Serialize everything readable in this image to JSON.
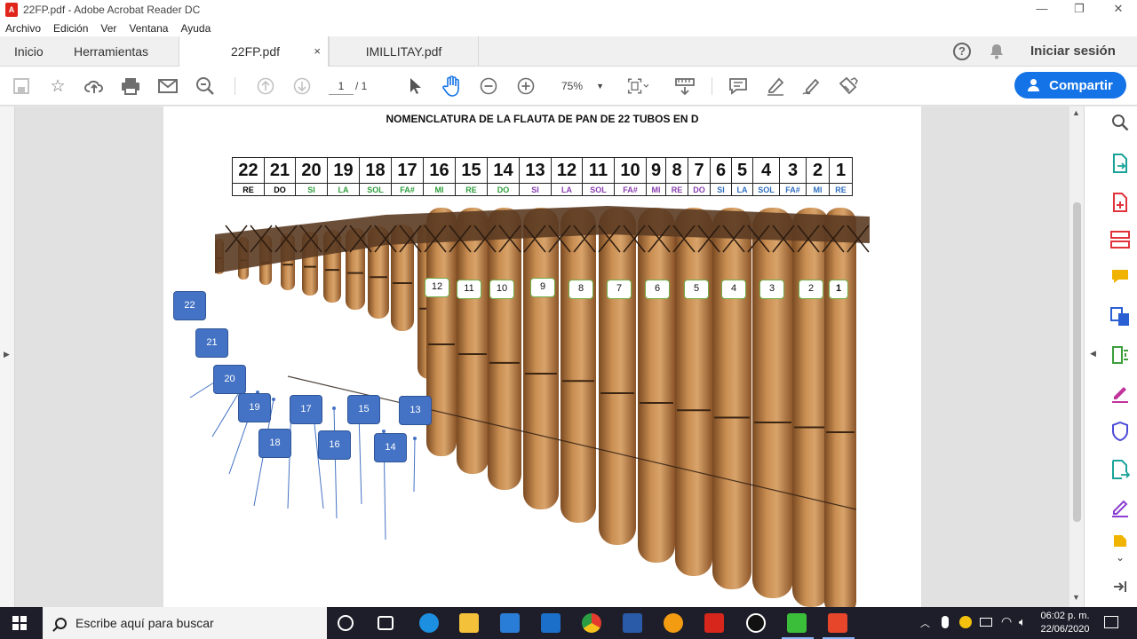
{
  "window": {
    "title": "22FP.pdf - Adobe Acrobat Reader DC",
    "controls": {
      "minimize": "—",
      "restore": "❐",
      "close": "✕"
    }
  },
  "menu": [
    "Archivo",
    "Edición",
    "Ver",
    "Ventana",
    "Ayuda"
  ],
  "tabs": {
    "home": "Inicio",
    "tools": "Herramientas",
    "documents": [
      {
        "label": "22FP.pdf",
        "close": "×",
        "active": true
      },
      {
        "label": "IMILLITAY.pdf",
        "active": false
      }
    ],
    "help_icon": "?",
    "signin": "Iniciar sesión"
  },
  "toolbar": {
    "page_current": "1",
    "page_total": "/   1",
    "zoom": "75%",
    "share": "Compartir"
  },
  "document": {
    "title": "NOMENCLATURA DE LA FLAUTA DE PAN DE 22 TUBOS EN D",
    "table": [
      {
        "num": "22",
        "note": "RE",
        "color": "#000000"
      },
      {
        "num": "21",
        "note": "DO",
        "color": "#000000"
      },
      {
        "num": "20",
        "note": "SI",
        "color": "#2e9e3b"
      },
      {
        "num": "19",
        "note": "LA",
        "color": "#2e9e3b"
      },
      {
        "num": "18",
        "note": "SOL",
        "color": "#2e9e3b"
      },
      {
        "num": "17",
        "note": "FA#",
        "color": "#2e9e3b"
      },
      {
        "num": "16",
        "note": "MI",
        "color": "#2e9e3b"
      },
      {
        "num": "15",
        "note": "RE",
        "color": "#2e9e3b"
      },
      {
        "num": "14",
        "note": "DO",
        "color": "#2e9e3b"
      },
      {
        "num": "13",
        "note": "SI",
        "color": "#8a3fb0"
      },
      {
        "num": "12",
        "note": "LA",
        "color": "#8a3fb0"
      },
      {
        "num": "11",
        "note": "SOL",
        "color": "#8a3fb0"
      },
      {
        "num": "10",
        "note": "FA#",
        "color": "#8a3fb0"
      },
      {
        "num": "9",
        "note": "MI",
        "color": "#8a3fb0"
      },
      {
        "num": "8",
        "note": "RE",
        "color": "#8a3fb0"
      },
      {
        "num": "7",
        "note": "DO",
        "color": "#8a3fb0"
      },
      {
        "num": "6",
        "note": "SI",
        "color": "#2f6fbf"
      },
      {
        "num": "5",
        "note": "LA",
        "color": "#2f6fbf"
      },
      {
        "num": "4",
        "note": "SOL",
        "color": "#2f6fbf"
      },
      {
        "num": "3",
        "note": "FA#",
        "color": "#2f6fbf"
      },
      {
        "num": "2",
        "note": "MI",
        "color": "#2f6fbf"
      },
      {
        "num": "1",
        "note": "RE",
        "color": "#2f6fbf"
      }
    ],
    "front_labels": [
      "12",
      "11",
      "10",
      "9",
      "8",
      "7",
      "6",
      "5",
      "4",
      "3",
      "2",
      "1"
    ],
    "back_labels": [
      "22",
      "21",
      "20",
      "19",
      "18",
      "17",
      "16",
      "15",
      "14",
      "13"
    ]
  },
  "taskbar": {
    "search_placeholder": "Escribe aquí para buscar",
    "time": "06:02 p. m.",
    "date": "22/06/2020"
  },
  "colors": {
    "accent": "#1473e6",
    "label_blue": "#4472c4",
    "label_green_border": "#70ad47",
    "bamboo": "#b87a45"
  }
}
